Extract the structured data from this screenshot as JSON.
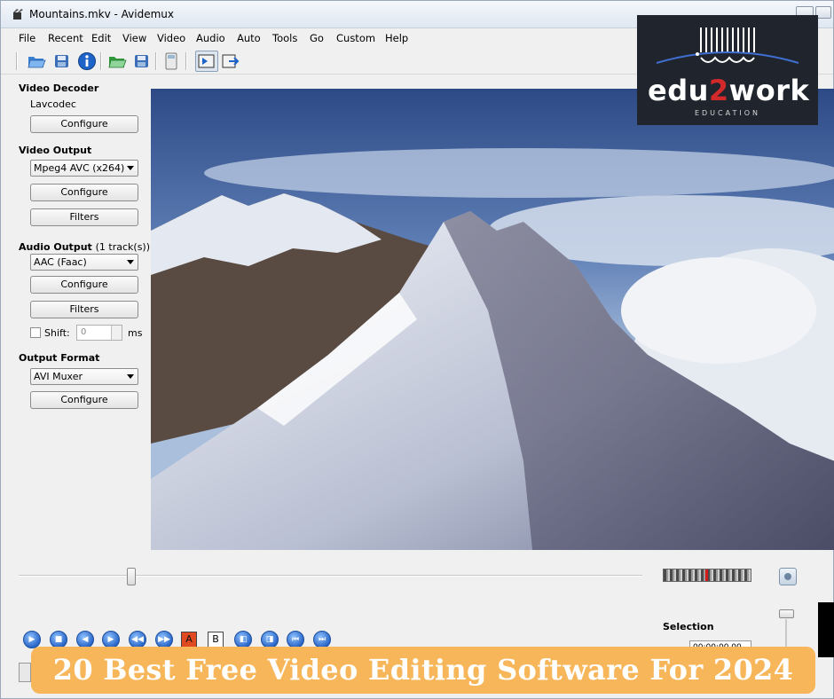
{
  "window": {
    "title": "Mountains.mkv - Avidemux"
  },
  "menu": [
    "File",
    "Recent",
    "Edit",
    "View",
    "Video",
    "Audio",
    "Auto",
    "Tools",
    "Go",
    "Custom",
    "Help"
  ],
  "toolbar": {
    "icons": [
      "open-folder-icon",
      "save-icon",
      "info-icon",
      "open-folder-green-icon",
      "save-video-icon",
      "calculator-icon",
      "input-mode-icon",
      "output-mode-icon"
    ]
  },
  "video_decoder": {
    "title": "Video Decoder",
    "codec": "Lavcodec",
    "configure": "Configure"
  },
  "video_output": {
    "title": "Video Output",
    "selected": "Mpeg4 AVC (x264)",
    "configure": "Configure",
    "filters": "Filters"
  },
  "audio_output": {
    "title": "Audio Output",
    "tracks": "(1 track(s))",
    "selected": "AAC (Faac)",
    "configure": "Configure",
    "filters": "Filters",
    "shift_label": "Shift:",
    "shift_value": "0",
    "shift_unit": "ms"
  },
  "output_format": {
    "title": "Output Format",
    "selected": "AVI Muxer",
    "configure": "Configure"
  },
  "logo": {
    "word_a": "edu",
    "word_b": "2",
    "word_c": "work",
    "sub": "EDUCATION"
  },
  "selection": {
    "title": "Selection",
    "value": "00:00:00.00"
  },
  "ab": {
    "a": "A",
    "b": "B"
  },
  "banner": {
    "text": "20 Best Free Video Editing Software For 2024"
  },
  "colors": {
    "banner": "#f7b65a",
    "logo_bg": "#20242c",
    "logo_accent": "#d22a2a"
  }
}
